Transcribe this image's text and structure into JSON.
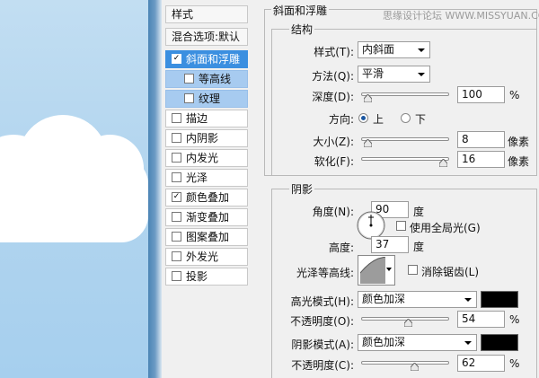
{
  "watermark": "思缘设计论坛 WWW.MISSYUAN.COM",
  "styles_list": {
    "header": "样式",
    "blend_options": "混合选项:默认",
    "items": [
      {
        "label": "斜面和浮雕",
        "checked": true,
        "selected": true
      },
      {
        "label": "等高线",
        "checked": false,
        "sub": true
      },
      {
        "label": "纹理",
        "checked": false,
        "sub": true
      },
      {
        "label": "描边",
        "checked": false
      },
      {
        "label": "内阴影",
        "checked": false
      },
      {
        "label": "内发光",
        "checked": false
      },
      {
        "label": "光泽",
        "checked": false
      },
      {
        "label": "颜色叠加",
        "checked": true
      },
      {
        "label": "渐变叠加",
        "checked": false
      },
      {
        "label": "图案叠加",
        "checked": false
      },
      {
        "label": "外发光",
        "checked": false
      },
      {
        "label": "投影",
        "checked": false
      }
    ]
  },
  "bevel": {
    "section_title": "斜面和浮雕",
    "structure_title": "结构",
    "style_label": "样式(T):",
    "style_value": "内斜面",
    "technique_label": "方法(Q):",
    "technique_value": "平滑",
    "depth_label": "深度(D):",
    "depth_value": "100",
    "depth_unit": "%",
    "depth_level": 0.03,
    "direction_label": "方向:",
    "direction_up": "上",
    "direction_down": "下",
    "size_label": "大小(Z):",
    "size_value": "8",
    "size_unit": "像素",
    "size_level": 0.03,
    "soften_label": "软化(F):",
    "soften_value": "16",
    "soften_unit": "像素",
    "soften_level": 0.98
  },
  "shading": {
    "title": "阴影",
    "angle_label": "角度(N):",
    "angle_value": "90",
    "angle_unit": "度",
    "global_light_label": "使用全局光(G)",
    "altitude_label": "高度:",
    "altitude_value": "37",
    "altitude_unit": "度",
    "gloss_label": "光泽等高线:",
    "antialias_label": "消除锯齿(L)",
    "highlight_mode_label": "高光模式(H):",
    "highlight_mode_value": "颜色加深",
    "highlight_color": "#000000",
    "highlight_opacity_label": "不透明度(O):",
    "highlight_opacity_value": "54",
    "highlight_opacity_level": 0.54,
    "shadow_mode_label": "阴影模式(A):",
    "shadow_mode_value": "颜色加深",
    "shadow_color": "#000000",
    "shadow_opacity_label": "不透明度(C):",
    "shadow_opacity_value": "62",
    "shadow_opacity_level": 0.62,
    "percent_unit": "%"
  }
}
